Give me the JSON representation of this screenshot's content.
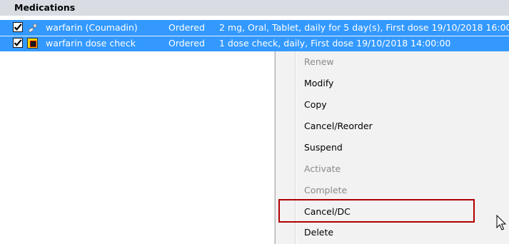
{
  "section": {
    "title": "Medications"
  },
  "medications": [
    {
      "name": "warfarin (Coumadin)",
      "status": "Ordered",
      "details": "2 mg, Oral, Tablet, daily for 5 day(s), First dose 19/10/2018 16:00",
      "icon": "pill-icon",
      "checked": true
    },
    {
      "name": "warfarin dose check",
      "status": "Ordered",
      "details": "1 dose check, daily, First dose 19/10/2018 14:00:00",
      "icon": "dose-check-icon",
      "checked": true
    }
  ],
  "context_menu": {
    "items": [
      {
        "label": "Renew",
        "enabled": false
      },
      {
        "label": "Modify",
        "enabled": true
      },
      {
        "label": "Copy",
        "enabled": true
      },
      {
        "label": "Cancel/Reorder",
        "enabled": true
      },
      {
        "label": "Suspend",
        "enabled": true
      },
      {
        "label": "Activate",
        "enabled": false
      },
      {
        "label": "Complete",
        "enabled": false
      },
      {
        "label": "Cancel/DC",
        "enabled": true,
        "highlighted": true
      },
      {
        "label": "Delete",
        "enabled": true
      }
    ]
  },
  "colors": {
    "selection": "#3399ff",
    "header": "#d9dde3",
    "menu_background": "#f2f2f2",
    "highlight_border": "#b00000",
    "disabled_text": "#8a8a8a"
  }
}
